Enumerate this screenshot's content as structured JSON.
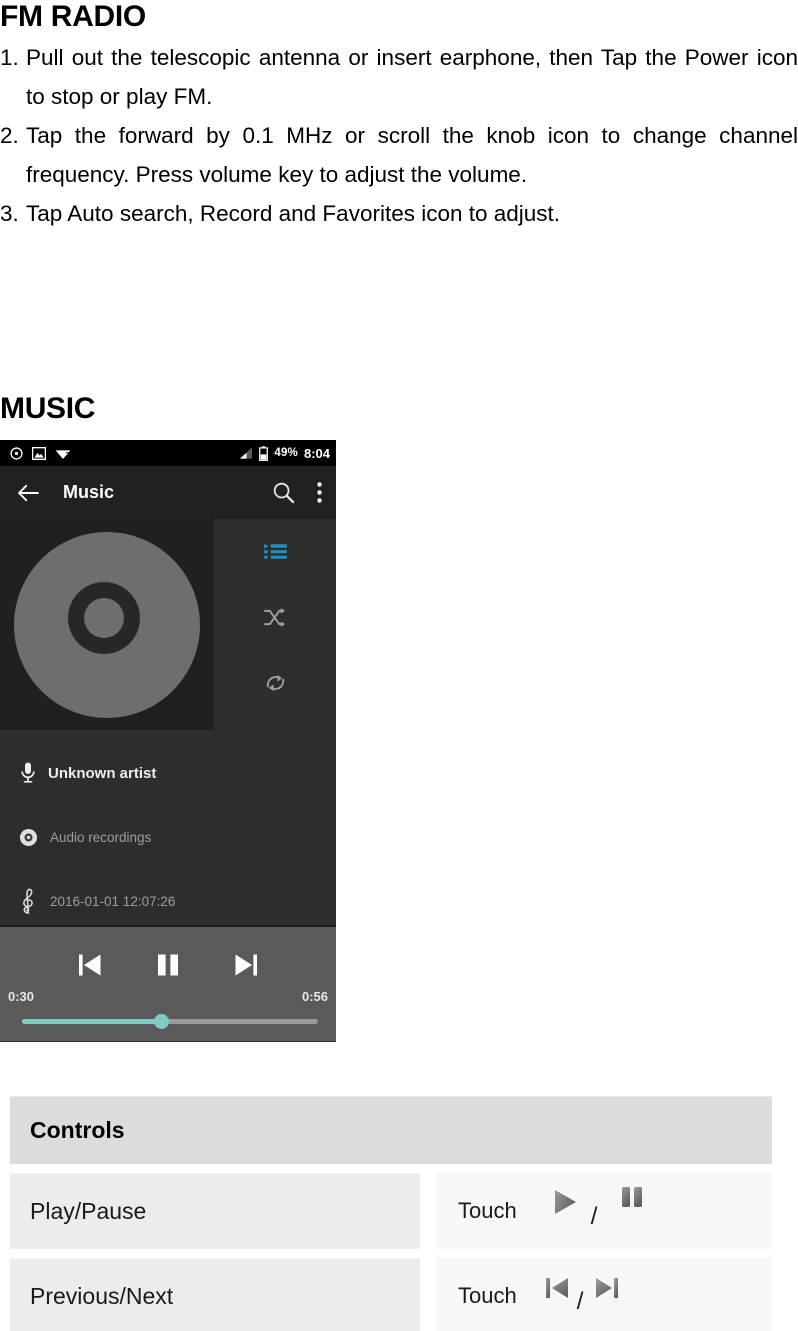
{
  "fm_section": {
    "title": "FM RADIO",
    "steps": [
      {
        "num": "1.",
        "text": "Pull out the telescopic antenna or insert earphone, then Tap the Power icon to stop or play FM."
      },
      {
        "num": "2.",
        "text": "Tap the forward by 0.1 MHz or scroll the knob icon to change channel frequency. Press volume key to adjust the volume."
      },
      {
        "num": "3.",
        "text": "Tap Auto search, Record and Favorites icon to adjust."
      }
    ]
  },
  "music_section": {
    "title": "MUSIC"
  },
  "phone": {
    "status_bar": {
      "icons": [
        "alarm-icon",
        "image-icon",
        "wifi-unknown-icon"
      ],
      "signal_icon": "signal-bars-icon",
      "battery_icon": "battery-icon",
      "battery_percent": "49%",
      "time": "8:04"
    },
    "toolbar": {
      "back_icon": "back-arrow-icon",
      "title": "Music",
      "search_icon": "search-icon",
      "overflow_icon": "overflow-menu-icon"
    },
    "album": {
      "art_icon": "cd-disc-icon"
    },
    "side_actions": [
      {
        "name": "playlist-icon",
        "color": "#1f8fc4"
      },
      {
        "name": "shuffle-icon",
        "color": "#9e9e9e"
      },
      {
        "name": "repeat-icon",
        "color": "#9e9e9e"
      }
    ],
    "track_meta": [
      {
        "icon": "microphone-icon",
        "label": "Unknown artist",
        "style": "primary"
      },
      {
        "icon": "disc-icon",
        "label": "Audio recordings",
        "style": "secondary"
      },
      {
        "icon": "treble-clef-icon",
        "label": "2016-01-01 12:07:26",
        "style": "secondary"
      }
    ],
    "player": {
      "previous_icon": "previous-track-icon",
      "pause_icon": "pause-icon",
      "next_icon": "next-track-icon",
      "elapsed": "0:30",
      "duration": "0:56",
      "progress_percent": 47,
      "progress_color": "#7ecdc4",
      "track_color": "#9a9a9a"
    }
  },
  "controls_table": {
    "header": "Controls",
    "rows": [
      {
        "label": "Play/Pause",
        "action": "Touch",
        "separator": "/",
        "icon_a": "play-icon",
        "icon_b": "pause-icon"
      },
      {
        "label": "Previous/Next",
        "action": "Touch",
        "separator": "/",
        "icon_a": "previous-track-icon",
        "icon_b": "next-track-icon"
      }
    ]
  }
}
